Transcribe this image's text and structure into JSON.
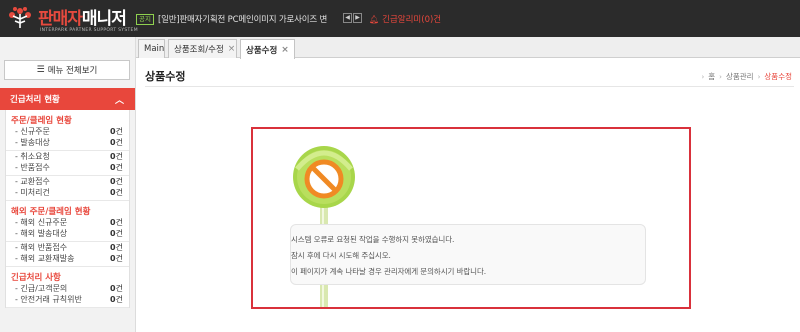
{
  "header": {
    "logo_text_accent": "판매자",
    "logo_text_rest": "매니저",
    "logo_sub": "INTERPARK PARTNER SUPPORT SYSTEM",
    "notice_badge": "공지",
    "notice_text": "[일반]판매자기획전 PC메인이미지 가로사이즈 변",
    "prev_icon": "chevron-left-icon",
    "next_icon": "chevron-right-icon",
    "urgent_label": "긴급알리미",
    "urgent_count": "(0)건"
  },
  "tabs": [
    {
      "label": "Main",
      "closable": false,
      "active": false
    },
    {
      "label": "상품조회/수정",
      "closable": true,
      "active": false
    },
    {
      "label": "상품수정",
      "closable": true,
      "active": true
    }
  ],
  "sidebar": {
    "menu_all_label": "메뉴 전체보기",
    "urgent_header": "긴급처리 현황",
    "sections": [
      {
        "title": "주문/클레임 현황",
        "groups": [
          [
            {
              "label": "- 신규주문",
              "count": "0",
              "unit": "건"
            },
            {
              "label": "- 발송대상",
              "count": "0",
              "unit": "건"
            }
          ],
          [
            {
              "label": "- 취소요청",
              "count": "0",
              "unit": "건"
            },
            {
              "label": "- 반품접수",
              "count": "0",
              "unit": "건"
            }
          ],
          [
            {
              "label": "- 교환접수",
              "count": "0",
              "unit": "건"
            },
            {
              "label": "- 미처리건",
              "count": "0",
              "unit": "건"
            }
          ]
        ]
      },
      {
        "title": "해외 주문/클레임 현황",
        "groups": [
          [
            {
              "label": "- 해외 신규주문",
              "count": "0",
              "unit": "건"
            },
            {
              "label": "- 해외 발송대상",
              "count": "0",
              "unit": "건"
            }
          ],
          [
            {
              "label": "- 해외 반품접수",
              "count": "0",
              "unit": "건"
            },
            {
              "label": "- 해외 교환재발송",
              "count": "0",
              "unit": "건"
            }
          ]
        ]
      },
      {
        "title": "긴급처리 사항",
        "groups": [
          [
            {
              "label": "- 긴급/고객문의",
              "count": "0",
              "unit": "건"
            },
            {
              "label": "- 안전거래 규칙위반",
              "count": "0",
              "unit": "건"
            }
          ]
        ]
      }
    ]
  },
  "main": {
    "page_title": "상품수정",
    "breadcrumb": [
      "홈",
      "상품관리",
      "상품수정"
    ],
    "error_lines": [
      "시스템 오류로 요청된 작업을 수행하지 못하였습니다.",
      "잠시 후에 다시 시도해 주십시오.",
      "이 페이지가 계속 나타날 경우 관리자에게 문의하시기 바랍니다."
    ]
  },
  "colors": {
    "accent": "#e8473c",
    "topbar": "#2b2b2b",
    "notice_badge": "#8fd14f",
    "lollipop_green": "#a8d64a",
    "lollipop_orange": "#f08a24"
  }
}
